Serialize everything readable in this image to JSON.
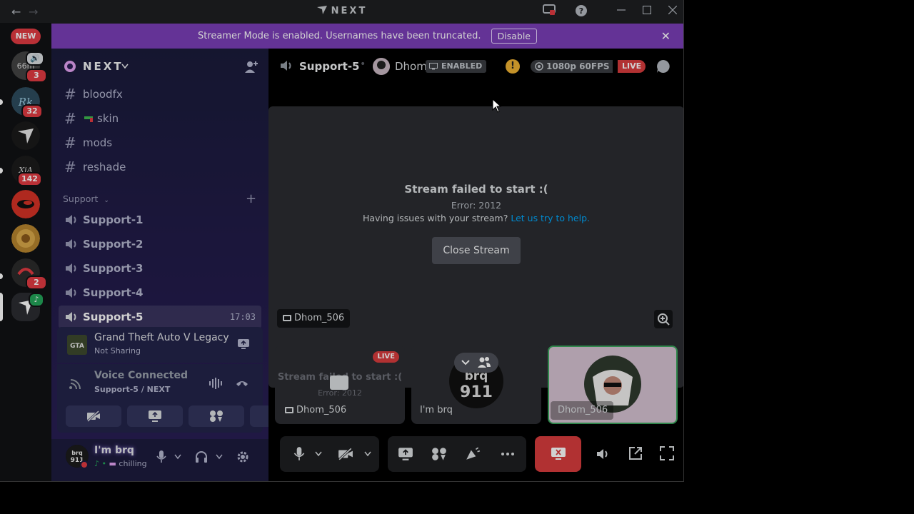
{
  "titlebar": {
    "title": "NEXT",
    "back": "←",
    "forward": "→"
  },
  "banner": {
    "text": "Streamer Mode is enabled. Usernames have been truncated.",
    "button": "Disable",
    "close": "✕"
  },
  "rail": {
    "new_label": "NEW",
    "servers": [
      {
        "name": "server-66m",
        "label": "66m",
        "badge": "3",
        "bg": "#3a3a3a"
      },
      {
        "name": "server-rk",
        "label": "Rk",
        "badge": "32",
        "bg": "#2b3a4a"
      },
      {
        "name": "server-next",
        "label": "",
        "badge": "",
        "bg": "#1a1a1a"
      },
      {
        "name": "server-xia",
        "label": "XIA",
        "badge": "142",
        "bg": "#222"
      },
      {
        "name": "server-red",
        "label": "",
        "badge": "",
        "bg": "#d63327"
      },
      {
        "name": "server-gold",
        "label": "",
        "badge": "",
        "bg": "#b38a2e"
      },
      {
        "name": "server-mark",
        "label": "",
        "badge": "2",
        "bg": "#2a2a2a"
      },
      {
        "name": "server-active",
        "label": "",
        "badge": "",
        "bg": "#2b2d31"
      }
    ]
  },
  "sidebar": {
    "guild_name": "NEXT",
    "text_channels": [
      {
        "label": "bloodfx"
      },
      {
        "label": "skin"
      },
      {
        "label": "mods"
      },
      {
        "label": "reshade"
      }
    ],
    "category": "Support",
    "voice_channels": [
      {
        "label": "Support-1"
      },
      {
        "label": "Support-2"
      },
      {
        "label": "Support-3"
      },
      {
        "label": "Support-4"
      },
      {
        "label": "Support-5",
        "time": "17:03"
      }
    ],
    "game": {
      "title": "Grand Theft Auto V Legacy",
      "status": "Not Sharing"
    },
    "voice": {
      "status": "Voice Connected",
      "channel": "Support-5 / NEXT"
    },
    "user": {
      "name": "I'm brq",
      "status": "chilling",
      "avatar": "brq\n911"
    }
  },
  "topbar": {
    "channel": "Support-5",
    "user": "Dhom",
    "enabled_label": "ENABLED",
    "quality": "1080p 60FPS",
    "live": "LIVE"
  },
  "stream": {
    "title": "Stream failed to start :(",
    "error": "Error: 2012",
    "help_text": "Having issues with your stream?",
    "help_link": "Let us try to help.",
    "close_button": "Close Stream",
    "owner": "Dhom_506"
  },
  "tiles": [
    {
      "name": "Dhom_506",
      "live": "LIVE",
      "title": "Stream failed to start :(",
      "error": "Error: 2012"
    },
    {
      "name": "I'm brq",
      "avatar_text": "brq\n911"
    },
    {
      "name": "Dhom_506"
    }
  ]
}
